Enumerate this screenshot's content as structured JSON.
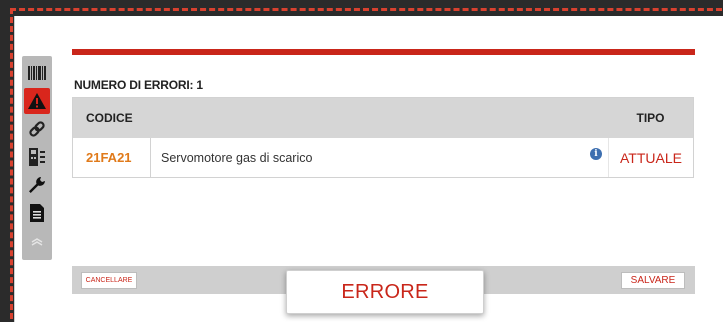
{
  "sidebar": {
    "items": [
      {
        "icon": "barcode-icon",
        "active": false
      },
      {
        "icon": "warning-icon",
        "active": true
      },
      {
        "icon": "link-icon",
        "active": false
      },
      {
        "icon": "device-icon",
        "active": false
      },
      {
        "icon": "wrench-icon",
        "active": false
      },
      {
        "icon": "document-icon",
        "active": false
      }
    ],
    "collapse_icon": "chevron-icon"
  },
  "errors": {
    "count_label": "NUMERO DI ERRORI: 1",
    "columns": {
      "code": "CODICE",
      "description": "",
      "type": "TIPO"
    },
    "rows": [
      {
        "code": "21FA21",
        "description": "Servomotore gas di scarico",
        "type": "ATTUALE"
      }
    ]
  },
  "footer": {
    "cancel_label": "CANCELLARE",
    "save_label": "SALVARE"
  },
  "popup": {
    "label": "ERRORE"
  },
  "colors": {
    "accent_red": "#c9261a",
    "code_orange": "#e07a1a",
    "info_blue": "#3d6fb0"
  }
}
